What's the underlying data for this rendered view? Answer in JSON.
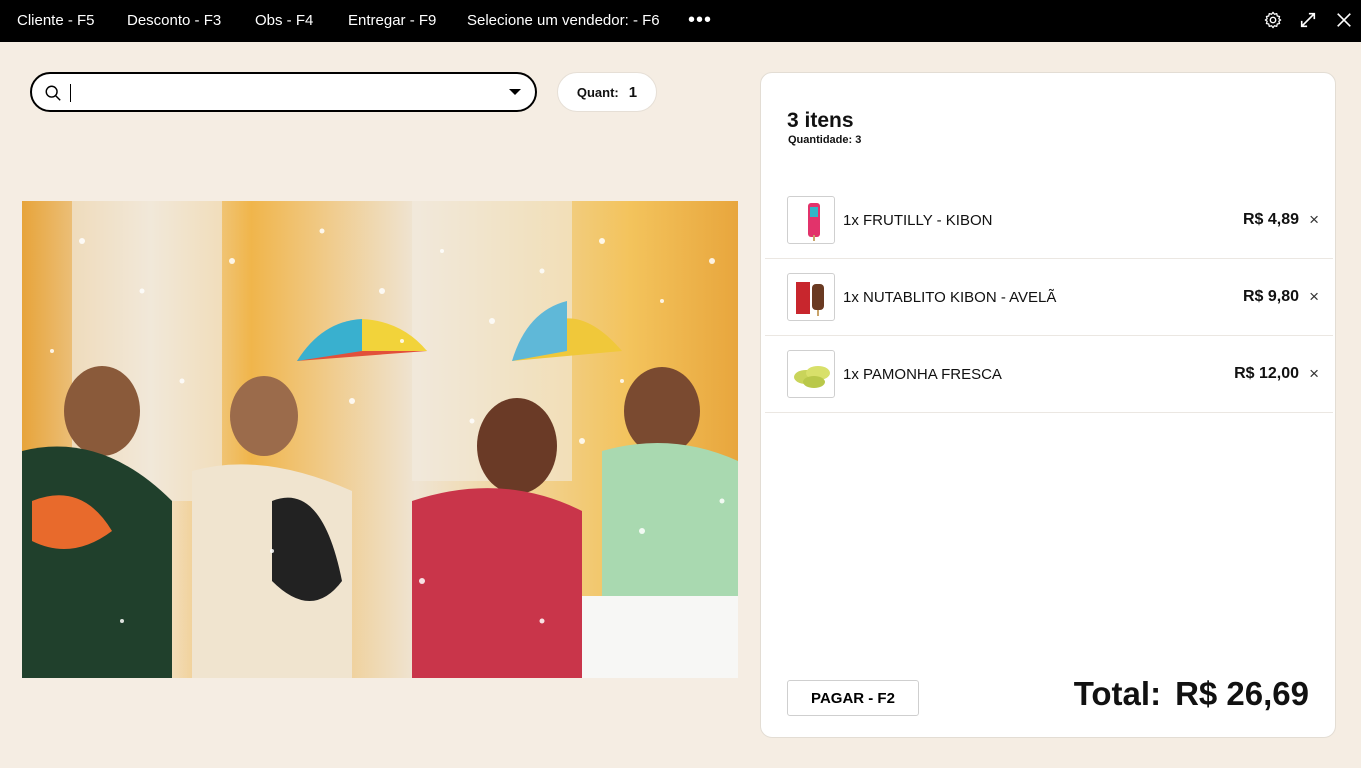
{
  "topbar": {
    "menu": [
      {
        "label": "Cliente - F5"
      },
      {
        "label": "Desconto - F3"
      },
      {
        "label": "Obs - F4"
      },
      {
        "label": "Entregar - F9"
      },
      {
        "label": "Selecione um vendedor: - F6"
      }
    ],
    "more": "•••",
    "settings_icon": "gear-icon",
    "expand_icon": "expand-icon",
    "close_icon": "close-icon"
  },
  "search": {
    "value": "",
    "placeholder": ""
  },
  "quant": {
    "label": "Quant:",
    "value": "1"
  },
  "cart": {
    "title": "3 itens",
    "subtitle": "Quantidade: 3",
    "items": [
      {
        "label": "1x FRUTILLY - KIBON",
        "price": "R$ 4,89"
      },
      {
        "label": "1x NUTABLITO KIBON - AVELÃ",
        "price": "R$ 9,80"
      },
      {
        "label": "1x PAMONHA FRESCA",
        "price": "R$ 12,00"
      }
    ],
    "remove_symbol": "×",
    "pay_label": "PAGAR - F2",
    "total_label": "Total:",
    "total_value": "R$ 26,69"
  },
  "colors": {
    "background": "#f5ede3",
    "topbar": "#000000",
    "panel": "#ffffff"
  }
}
